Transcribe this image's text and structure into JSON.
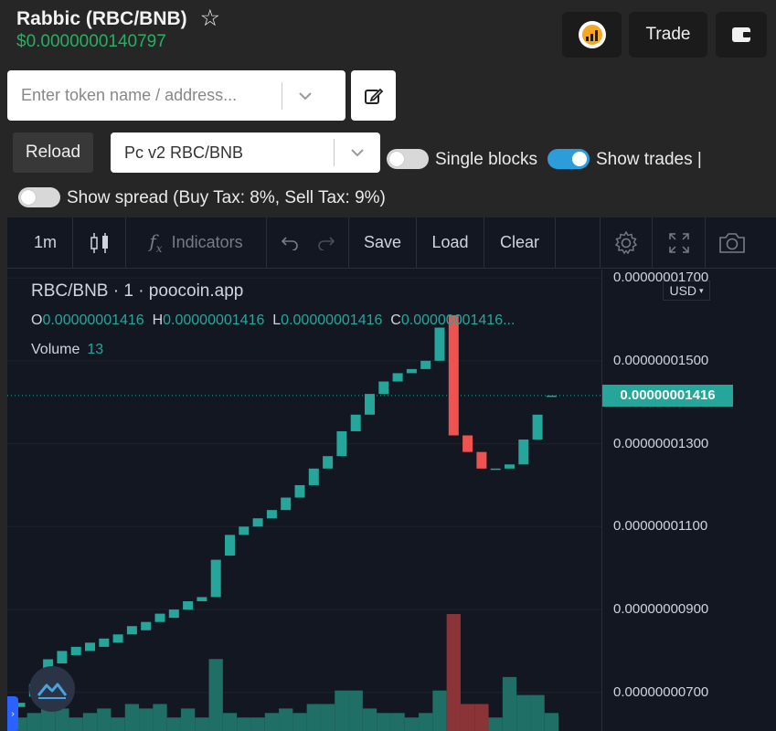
{
  "token": {
    "title": "Rabbic (RBC/BNB)",
    "price": "$0.0000000140797"
  },
  "top_buttons": {
    "trade_label": "Trade"
  },
  "search": {
    "placeholder": "Enter token name / address..."
  },
  "controls": {
    "reload_label": "Reload",
    "pair_value": "Pc v2 RBC/BNB",
    "single_blocks_label": "Single blocks",
    "single_blocks_on": false,
    "show_trades_label": "Show trades |",
    "show_trades_on": true,
    "show_spread_label": "Show spread (Buy Tax: 8%, Sell Tax: 9%)",
    "show_spread_on": false
  },
  "toolbar": {
    "interval": "1m",
    "indicators_label": "Indicators",
    "save_label": "Save",
    "load_label": "Load",
    "clear_label": "Clear"
  },
  "legend": {
    "symbol_line": "RBC/BNB · 1 · poocoin.app",
    "o_label": "O",
    "o_value": "0.00000001416",
    "h_label": "H",
    "h_value": "0.00000001416",
    "l_label": "L",
    "l_value": "0.00000001416",
    "c_label": "C",
    "c_value": "0.00000001416...",
    "volume_label": "Volume",
    "volume_value": "13"
  },
  "axis": {
    "currency": "USD",
    "last_price": "0.00000001416"
  },
  "colors": {
    "up": "#26a69a",
    "down": "#ef5350",
    "up_volume": "#1f6f67",
    "down_volume": "#8a3438",
    "accent_green": "#27ae60"
  },
  "chart_data": {
    "type": "candlestick",
    "price_unit": "USD",
    "y_ticks": [
      {
        "label": "0.00000001700",
        "value": 1.7e-08
      },
      {
        "label": "0.00000001500",
        "value": 1.5e-08
      },
      {
        "label": "0.00000001300",
        "value": 1.3e-08
      },
      {
        "label": "0.00000001100",
        "value": 1.1e-08
      },
      {
        "label": "0.00000000900",
        "value": 9e-09
      },
      {
        "label": "0.00000000700",
        "value": 7e-09
      }
    ],
    "ylim": [
      6.07e-09,
      1.72e-08
    ],
    "candles": [
      {
        "o": 6.65e-09,
        "c": 6.75e-09,
        "v": 0.3
      },
      {
        "o": 6.9e-09,
        "c": 7.2e-09,
        "v": 0.4
      },
      {
        "o": 7.2e-09,
        "c": 7.8e-09,
        "v": 1.3
      },
      {
        "o": 7.7e-09,
        "c": 8e-09,
        "v": 0.5
      },
      {
        "o": 7.9e-09,
        "c": 8.1e-09,
        "v": 0.3
      },
      {
        "o": 8e-09,
        "c": 8.2e-09,
        "v": 0.4
      },
      {
        "o": 8.1e-09,
        "c": 8.3e-09,
        "v": 0.5
      },
      {
        "o": 8.2e-09,
        "c": 8.4e-09,
        "v": 0.3
      },
      {
        "o": 8.4e-09,
        "c": 8.6e-09,
        "v": 0.6
      },
      {
        "o": 8.5e-09,
        "c": 8.7e-09,
        "v": 0.5
      },
      {
        "o": 8.7e-09,
        "c": 8.9e-09,
        "v": 0.6
      },
      {
        "o": 8.8e-09,
        "c": 9e-09,
        "v": 0.3
      },
      {
        "o": 9e-09,
        "c": 9.2e-09,
        "v": 0.5
      },
      {
        "o": 9.2e-09,
        "c": 9.3e-09,
        "v": 0.3
      },
      {
        "o": 9.3e-09,
        "c": 1.02e-08,
        "v": 1.6
      },
      {
        "o": 1.03e-08,
        "c": 1.08e-08,
        "v": 0.4
      },
      {
        "o": 1.08e-08,
        "c": 1.1e-08,
        "v": 0.3
      },
      {
        "o": 1.1e-08,
        "c": 1.12e-08,
        "v": 0.3
      },
      {
        "o": 1.12e-08,
        "c": 1.14e-08,
        "v": 0.4
      },
      {
        "o": 1.14e-08,
        "c": 1.17e-08,
        "v": 0.5
      },
      {
        "o": 1.17e-08,
        "c": 1.2e-08,
        "v": 0.4
      },
      {
        "o": 1.2e-08,
        "c": 1.24e-08,
        "v": 0.6
      },
      {
        "o": 1.24e-08,
        "c": 1.27e-08,
        "v": 0.6
      },
      {
        "o": 1.27e-08,
        "c": 1.33e-08,
        "v": 0.9
      },
      {
        "o": 1.33e-08,
        "c": 1.37e-08,
        "v": 0.9
      },
      {
        "o": 1.37e-08,
        "c": 1.42e-08,
        "v": 0.5
      },
      {
        "o": 1.42e-08,
        "c": 1.45e-08,
        "v": 0.4
      },
      {
        "o": 1.45e-08,
        "c": 1.47e-08,
        "v": 0.4
      },
      {
        "o": 1.47e-08,
        "c": 1.48e-08,
        "v": 0.3
      },
      {
        "o": 1.48e-08,
        "c": 1.5e-08,
        "v": 0.4
      },
      {
        "o": 1.5e-08,
        "c": 1.58e-08,
        "v": 0.9
      },
      {
        "o": 1.61e-08,
        "c": 1.32e-08,
        "v": 2.6
      },
      {
        "o": 1.32e-08,
        "c": 1.28e-08,
        "v": 0.6
      },
      {
        "o": 1.28e-08,
        "c": 1.24e-08,
        "v": 0.6
      },
      {
        "o": 1.24e-08,
        "c": 1.24e-08,
        "v": 0.3
      },
      {
        "o": 1.24e-08,
        "c": 1.25e-08,
        "v": 1.2
      },
      {
        "o": 1.25e-08,
        "c": 1.31e-08,
        "v": 0.8
      },
      {
        "o": 1.31e-08,
        "c": 1.37e-08,
        "v": 0.8
      },
      {
        "o": 1.416e-08,
        "c": 1.416e-08,
        "v": 0.4
      }
    ],
    "last": 1.416e-08
  }
}
